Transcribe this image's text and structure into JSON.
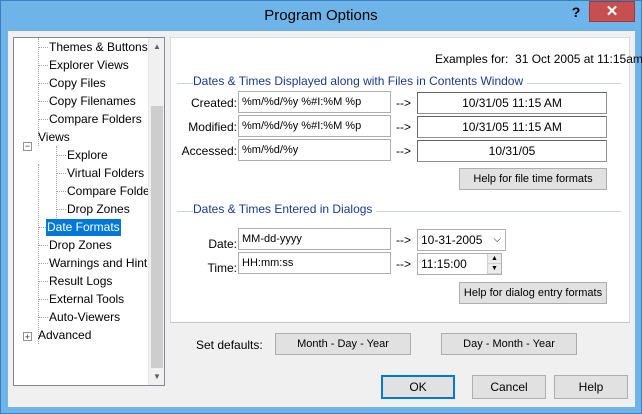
{
  "window": {
    "title": "Program Options",
    "help_glyph": "?",
    "close_glyph": "✕"
  },
  "tree": {
    "items": [
      {
        "label": "Themes & Buttons",
        "level": 1
      },
      {
        "label": "Explorer Views",
        "level": 1
      },
      {
        "label": "Copy Files",
        "level": 1
      },
      {
        "label": "Copy Filenames",
        "level": 1
      },
      {
        "label": "Compare Folders",
        "level": 1
      },
      {
        "label": "Views",
        "level": 0,
        "expander": "−"
      },
      {
        "label": "Explore",
        "level": 2
      },
      {
        "label": "Virtual Folders",
        "level": 2
      },
      {
        "label": "Compare Folde",
        "level": 2
      },
      {
        "label": "Drop Zones",
        "level": 2
      },
      {
        "label": "Date Formats",
        "level": 1,
        "selected": true
      },
      {
        "label": "Drop Zones",
        "level": 1
      },
      {
        "label": "Warnings and Hint",
        "level": 1
      },
      {
        "label": "Result Logs",
        "level": 1
      },
      {
        "label": "External Tools",
        "level": 1
      },
      {
        "label": "Auto-Viewers",
        "level": 1
      },
      {
        "label": "Advanced",
        "level": 0,
        "expander": "+"
      }
    ]
  },
  "examples": {
    "label": "Examples for:",
    "value": "31 Oct 2005 at 11:15am"
  },
  "files_group": {
    "title": "Dates & Times Displayed along with Files in Contents Window",
    "rows": [
      {
        "label": "Created:",
        "format": "%m/%d/%y %#I:%M %p",
        "arrow": "-->",
        "example": "10/31/05 11:15 AM"
      },
      {
        "label": "Modified:",
        "format": "%m/%d/%y %#I:%M %p",
        "arrow": "-->",
        "example": "10/31/05 11:15 AM"
      },
      {
        "label": "Accessed:",
        "format": "%m/%d/%y",
        "arrow": "-->",
        "example": "10/31/05"
      }
    ],
    "help_button": "Help for file time formats"
  },
  "dialogs_group": {
    "title": "Dates & Times Entered in Dialogs",
    "date_label": "Date:",
    "date_format": "MM-dd-yyyy",
    "date_arrow": "-->",
    "date_example": "10-31-2005",
    "time_label": "Time:",
    "time_format": "HH:mm:ss",
    "time_arrow": "-->",
    "time_example": "11:15:00",
    "help_button": "Help for dialog entry formats"
  },
  "defaults": {
    "label": "Set defaults:",
    "mdy_button": "Month - Day - Year",
    "dmy_button": "Day - Month - Year"
  },
  "footer": {
    "ok": "OK",
    "cancel": "Cancel",
    "help": "Help"
  }
}
